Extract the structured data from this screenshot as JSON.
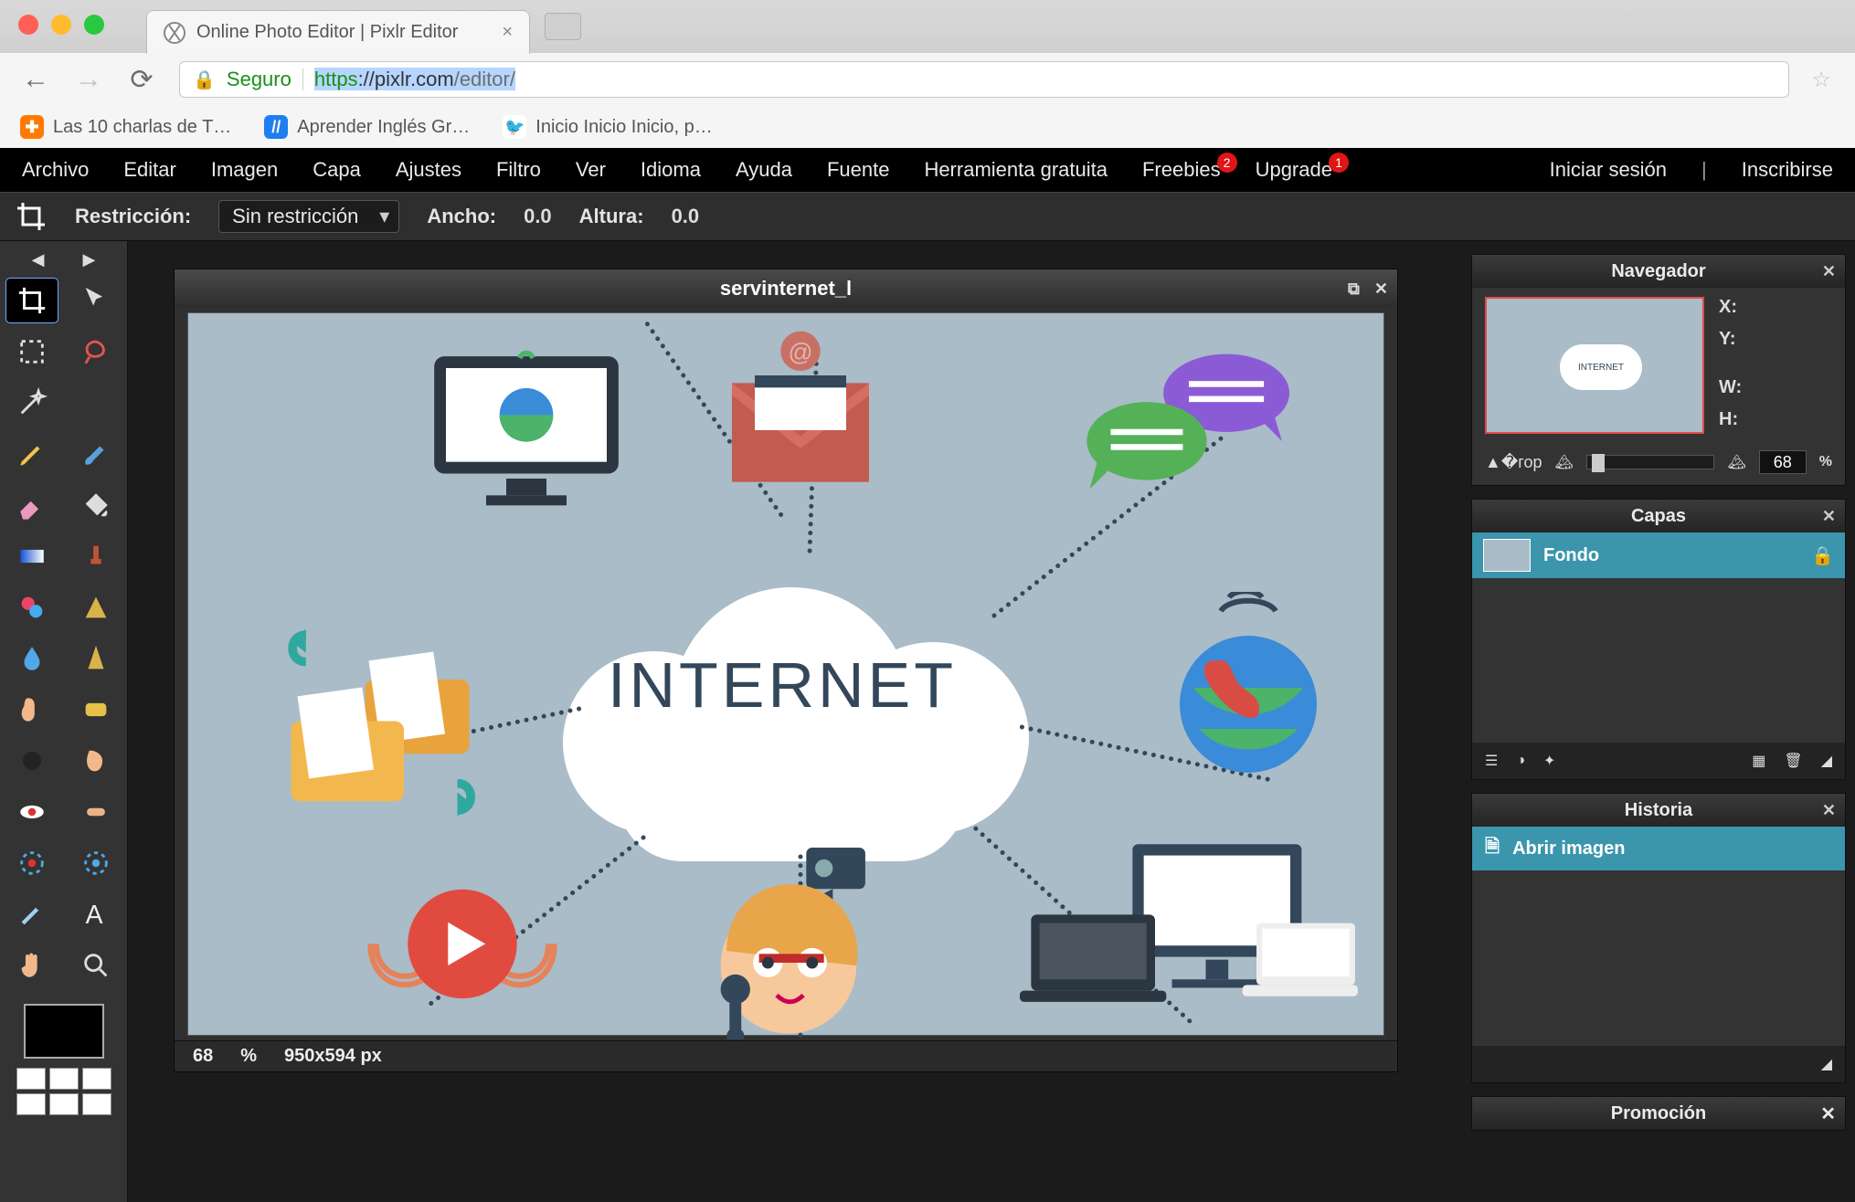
{
  "browser": {
    "tab_title": "Online Photo Editor | Pixlr Editor",
    "secure_label": "Seguro",
    "url_scheme": "https",
    "url_host": "://pixlr.com",
    "url_path": "/editor/",
    "bookmarks": [
      {
        "label": "Las 10 charlas de T…",
        "color": "#ff7a00",
        "glyph": "✦"
      },
      {
        "label": "Aprender Inglés Gr…",
        "color": "#1f7ff0",
        "glyph": "//"
      },
      {
        "label": "Inicio Inicio Inicio, p…",
        "color": "#1da1f2",
        "glyph": "🐦"
      }
    ]
  },
  "menus": {
    "file": "Archivo",
    "edit": "Editar",
    "image": "Imagen",
    "layer": "Capa",
    "adjust": "Ajustes",
    "filter": "Filtro",
    "view": "Ver",
    "language": "Idioma",
    "help": "Ayuda",
    "font": "Fuente",
    "freetool": "Herramienta gratuita",
    "freebies": "Freebies",
    "freebies_badge": "2",
    "upgrade": "Upgrade",
    "upgrade_badge": "1",
    "login": "Iniciar sesión",
    "signup": "Inscribirse"
  },
  "options": {
    "restriction_label": "Restricción:",
    "restriction_value": "Sin restricción",
    "width_label": "Ancho:",
    "width_value": "0.0",
    "height_label": "Altura:",
    "height_value": "0.0"
  },
  "document": {
    "title": "servinternet_l",
    "cloud_text": "INTERNET",
    "zoom_percent": "68",
    "zoom_unit": "%",
    "dimensions": "950x594 px"
  },
  "panels": {
    "navigator": {
      "title": "Navegador",
      "x_label": "X:",
      "y_label": "Y:",
      "w_label": "W:",
      "h_label": "H:",
      "zoom_value": "68",
      "zoom_unit": "%"
    },
    "layers": {
      "title": "Capas",
      "background_name": "Fondo"
    },
    "history": {
      "title": "Historia",
      "item": "Abrir imagen"
    },
    "promo": {
      "title": "Promoción"
    }
  },
  "tools": {
    "names": [
      "crop",
      "move",
      "marquee",
      "lasso",
      "wand",
      "pencil",
      "brush",
      "eraser",
      "paint-bucket",
      "gradient",
      "stamp",
      "color-replace",
      "draw-shape",
      "blur",
      "sharpen",
      "smudge",
      "sponge",
      "dodge",
      "burn",
      "red-eye",
      "spot-heal",
      "bloat",
      "pinch",
      "picker",
      "type",
      "hand",
      "zoom"
    ]
  }
}
